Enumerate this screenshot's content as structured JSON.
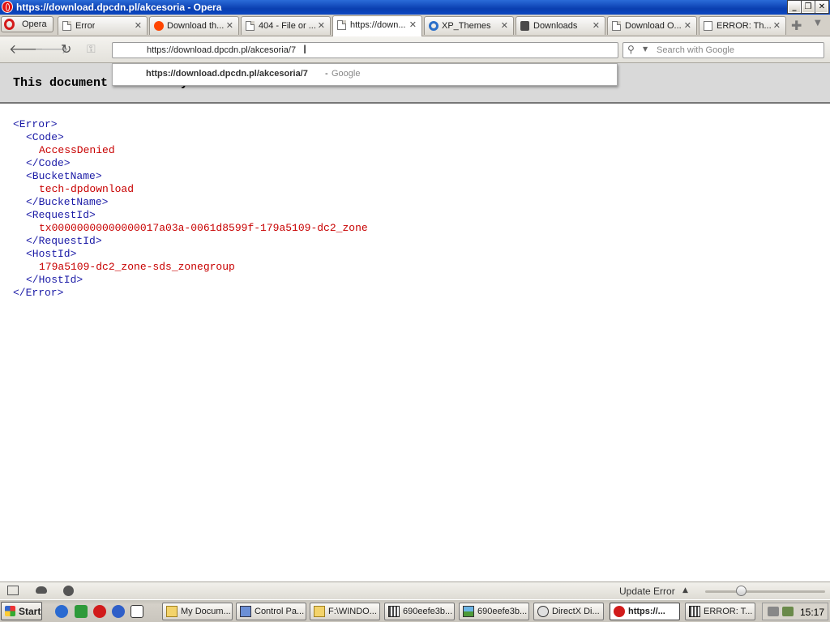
{
  "window": {
    "title": "https://download.dpcdn.pl/akcesoria - Opera",
    "minimize": "_",
    "maximize": "❐",
    "close": "✕"
  },
  "menu": {
    "label": "Opera"
  },
  "tabs": [
    {
      "label": "Error",
      "icon": "document-icon",
      "active": false
    },
    {
      "label": "Download th...",
      "icon": "reddit-icon",
      "active": false
    },
    {
      "label": "404 - File or ...",
      "icon": "document-icon",
      "active": false
    },
    {
      "label": "https://down...",
      "icon": "document-icon",
      "active": true
    },
    {
      "label": "XP_Themes",
      "icon": "xp-themes-icon",
      "active": false
    },
    {
      "label": "Downloads",
      "icon": "downloads-icon",
      "active": false
    },
    {
      "label": "Download O...",
      "icon": "document-icon",
      "active": false
    },
    {
      "label": "ERROR: Th...",
      "icon": "document-icon",
      "active": false
    }
  ],
  "tab_close_glyph": "✕",
  "new_tab_glyph": "✚",
  "tab_menu_glyph": "▼",
  "toolbar": {
    "back_glyph": "🡐",
    "forward_glyph": "🡒",
    "reload_glyph": "↻",
    "key_glyph": "⚿",
    "address_value": "https://download.dpcdn.pl/akcesoria/7",
    "cursor_glyph": "I",
    "search_placeholder": "Search with Google",
    "search_icon_glyph": "⚲",
    "search_arrow_glyph": "▼"
  },
  "autocomplete": {
    "url": "https://download.dpcdn.pl/akcesoria/7",
    "separator": "-",
    "source": "Google"
  },
  "page": {
    "notice": "This document had no style information.",
    "xml": {
      "root_open": "<Error>",
      "code_open": "<Code>",
      "code_value": "AccessDenied",
      "code_close": "</Code>",
      "bucket_open": "<BucketName>",
      "bucket_value": "tech-dpdownload",
      "bucket_close": "</BucketName>",
      "request_open": "<RequestId>",
      "request_value": "tx00000000000000017a03a-0061d8599f-179a5109-dc2_zone",
      "request_close": "</RequestId>",
      "host_open": "<HostId>",
      "host_value": "179a5109-dc2_zone-sds_zonegroup",
      "host_close": "</HostId>",
      "root_close": "</Error>"
    }
  },
  "statusbar": {
    "update_label": "Update Error",
    "update_arrow": "▲",
    "zoom_fraction": 0.28
  },
  "taskbar": {
    "start_label": "Start",
    "tasks": [
      {
        "label": "My Docum...",
        "icon": "folder-icon",
        "active": false
      },
      {
        "label": "Control Pa...",
        "icon": "control-panel-icon",
        "active": false
      },
      {
        "label": "F:\\WINDO...",
        "icon": "folder-icon",
        "active": false
      },
      {
        "label": "690eefe3b...",
        "icon": "image-grid-icon",
        "active": false
      },
      {
        "label": "690eefe3b...",
        "icon": "picture-icon",
        "active": false
      },
      {
        "label": "DirectX Di...",
        "icon": "directx-icon",
        "active": false
      },
      {
        "label": "https://...",
        "icon": "opera-icon",
        "active": true
      },
      {
        "label": "ERROR: T...",
        "icon": "image-grid-icon",
        "active": false
      }
    ],
    "clock": "15:17"
  }
}
